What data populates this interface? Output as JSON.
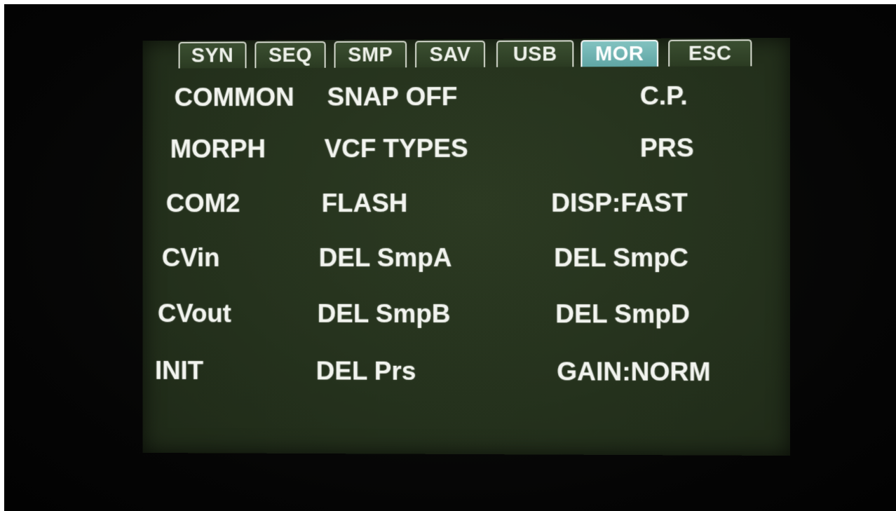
{
  "tabs": [
    {
      "label": "SYN"
    },
    {
      "label": "SEQ"
    },
    {
      "label": "SMP"
    },
    {
      "label": "SAV"
    },
    {
      "label": "USB"
    },
    {
      "label": "MOR",
      "active": true
    },
    {
      "label": "ESC"
    }
  ],
  "menu": {
    "col1": [
      "COMMON",
      "MORPH",
      "COM2",
      "CVin",
      "CVout",
      "INIT"
    ],
    "col2": [
      "SNAP OFF",
      "VCF TYPES",
      "FLASH",
      "DEL SmpA",
      "DEL SmpB",
      "DEL Prs"
    ],
    "col3": [
      "C.P.",
      "PRS",
      "DISP:FAST",
      "DEL SmpC",
      "DEL SmpD",
      "GAIN:NORM"
    ]
  }
}
